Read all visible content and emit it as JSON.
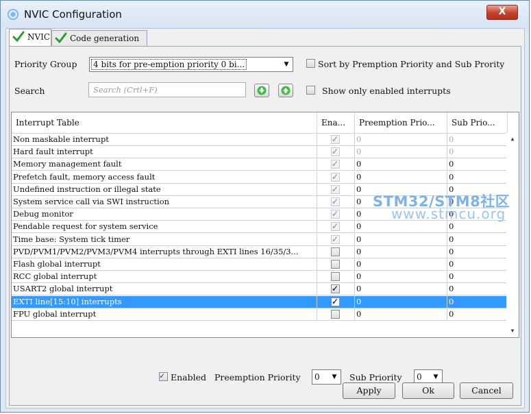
{
  "window": {
    "title": "NVIC Configuration",
    "close_label": "X"
  },
  "tabs": [
    {
      "label": "NVIC",
      "active": true
    },
    {
      "label": "Code generation",
      "active": false
    }
  ],
  "priority_group": {
    "label": "Priority Group",
    "value": "4 bits for pre-emption priority 0 bi..."
  },
  "sort": {
    "label": "Sort by Premption Priority and Sub Prority",
    "checked": false
  },
  "search": {
    "label": "Search",
    "placeholder": "Search (Crtl+F)"
  },
  "show_only": {
    "label": "Show only enabled interrupts",
    "checked": false
  },
  "table": {
    "columns": [
      "Interrupt Table",
      "Ena...",
      "Preemption Prio...",
      "Sub Prio..."
    ],
    "rows": [
      {
        "name": "Non maskable interrupt",
        "enabled": true,
        "locked": true,
        "preemption": "0",
        "sub": "0",
        "gray": true
      },
      {
        "name": "Hard fault interrupt",
        "enabled": true,
        "locked": true,
        "preemption": "0",
        "sub": "0",
        "gray": true
      },
      {
        "name": "Memory management fault",
        "enabled": true,
        "locked": true,
        "preemption": "0",
        "sub": "0",
        "gray": false
      },
      {
        "name": "Prefetch fault, memory access fault",
        "enabled": true,
        "locked": true,
        "preemption": "0",
        "sub": "0",
        "gray": false
      },
      {
        "name": "Undefined instruction or illegal state",
        "enabled": true,
        "locked": true,
        "preemption": "0",
        "sub": "0",
        "gray": false
      },
      {
        "name": "System service call via SWI instruction",
        "enabled": true,
        "locked": true,
        "preemption": "0",
        "sub": "0",
        "gray": false
      },
      {
        "name": "Debug monitor",
        "enabled": true,
        "locked": true,
        "preemption": "0",
        "sub": "0",
        "gray": false
      },
      {
        "name": "Pendable request for system service",
        "enabled": true,
        "locked": true,
        "preemption": "0",
        "sub": "0",
        "gray": false
      },
      {
        "name": "Time base: System tick timer",
        "enabled": true,
        "locked": true,
        "preemption": "0",
        "sub": "0",
        "gray": false
      },
      {
        "name": "PVD/PVM1/PVM2/PVM3/PVM4 interrupts through EXTI lines 16/35/3...",
        "enabled": false,
        "locked": false,
        "preemption": "0",
        "sub": "0",
        "gray": false
      },
      {
        "name": "Flash global interrupt",
        "enabled": false,
        "locked": false,
        "preemption": "0",
        "sub": "0",
        "gray": false
      },
      {
        "name": "RCC global interrupt",
        "enabled": false,
        "locked": false,
        "preemption": "0",
        "sub": "0",
        "gray": false
      },
      {
        "name": "USART2 global interrupt",
        "enabled": true,
        "locked": false,
        "preemption": "0",
        "sub": "0",
        "gray": false
      },
      {
        "name": "EXTI line[15:10] interrupts",
        "enabled": true,
        "locked": false,
        "preemption": "0",
        "sub": "0",
        "gray": false,
        "selected": true
      },
      {
        "name": "FPU global interrupt",
        "enabled": false,
        "locked": false,
        "preemption": "0",
        "sub": "0",
        "gray": false
      }
    ]
  },
  "detail": {
    "enabled_label": "Enabled",
    "enabled_checked": true,
    "preemption_label": "Preemption Priority",
    "preemption_value": "0",
    "sub_label": "Sub Priority",
    "sub_value": "0"
  },
  "buttons": {
    "apply": "Apply",
    "ok": "Ok",
    "cancel": "Cancel"
  },
  "watermark": {
    "line1": "STM32/STM8社区",
    "line2": "www.stmcu.org"
  }
}
